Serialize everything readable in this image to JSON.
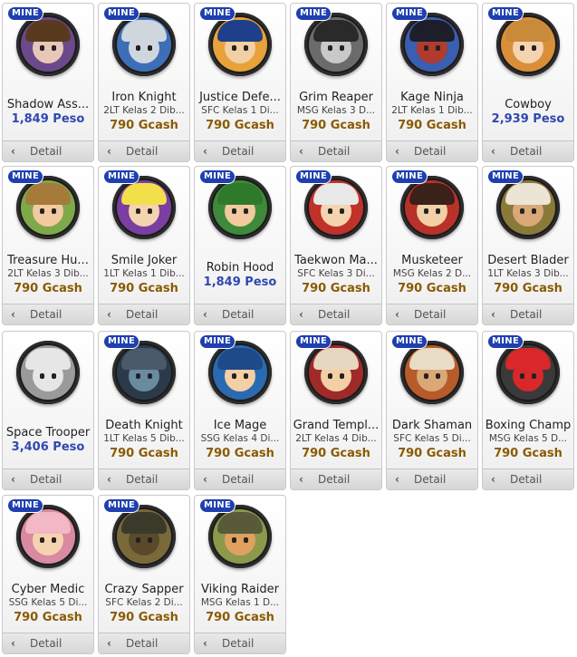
{
  "characters": [
    {
      "name": "Shadow Ass...",
      "requirement": "",
      "price": "1,849 Peso",
      "currency": "peso",
      "badge": "MINE",
      "detail": "Detail",
      "colors": {
        "bg": "#6a4a8a",
        "hat": "#5a3a1e",
        "face": "#e8c6b8"
      }
    },
    {
      "name": "Iron Knight",
      "requirement": "2LT Kelas 2  Dib...",
      "price": "790 Gcash",
      "currency": "gcash",
      "badge": "MINE",
      "detail": "Detail",
      "colors": {
        "bg": "#3d6fb8",
        "hat": "#cfd6de",
        "face": "#cfd6de"
      }
    },
    {
      "name": "Justice Defe...",
      "requirement": "SFC Kelas 1  Di...",
      "price": "790 Gcash",
      "currency": "gcash",
      "badge": "MINE",
      "detail": "Detail",
      "colors": {
        "bg": "#e8a23a",
        "hat": "#1f3f8a",
        "face": "#f2cfa4"
      }
    },
    {
      "name": "Grim Reaper",
      "requirement": "MSG Kelas 3  D...",
      "price": "790 Gcash",
      "currency": "gcash",
      "badge": "MINE",
      "detail": "Detail",
      "colors": {
        "bg": "#6b6b6b",
        "hat": "#2a2a2a",
        "face": "#c9c9c9"
      }
    },
    {
      "name": "Kage Ninja",
      "requirement": "2LT Kelas 1  Dib...",
      "price": "790 Gcash",
      "currency": "gcash",
      "badge": "MINE",
      "detail": "Detail",
      "colors": {
        "bg": "#3a5fb0",
        "hat": "#1e1e2a",
        "face": "#b23a2e"
      }
    },
    {
      "name": "Cowboy",
      "requirement": "",
      "price": "2,939 Peso",
      "currency": "peso",
      "badge": "MINE",
      "detail": "Detail",
      "colors": {
        "bg": "#d98f3a",
        "hat": "#c98a3a",
        "face": "#f6d3b0"
      }
    },
    {
      "name": "Treasure Hu...",
      "requirement": "2LT Kelas 3  Dib...",
      "price": "790 Gcash",
      "currency": "gcash",
      "badge": "MINE",
      "detail": "Detail",
      "colors": {
        "bg": "#7fa84a",
        "hat": "#a57a3a",
        "face": "#f2c9a0"
      }
    },
    {
      "name": "Smile Joker",
      "requirement": "1LT Kelas 1  Dib...",
      "price": "790 Gcash",
      "currency": "gcash",
      "badge": "MINE",
      "detail": "Detail",
      "colors": {
        "bg": "#7a3fa0",
        "hat": "#f2e04a",
        "face": "#f6d3b0"
      }
    },
    {
      "name": "Robin Hood",
      "requirement": "",
      "price": "1,849 Peso",
      "currency": "peso",
      "badge": "MINE",
      "detail": "Detail",
      "colors": {
        "bg": "#3f8a3a",
        "hat": "#2f7a2a",
        "face": "#f2c9a0"
      }
    },
    {
      "name": "Taekwon Ma...",
      "requirement": "SFC Kelas 3  Di...",
      "price": "790 Gcash",
      "currency": "gcash",
      "badge": "MINE",
      "detail": "Detail",
      "colors": {
        "bg": "#c0322a",
        "hat": "#e8e8e8",
        "face": "#f6d3b0"
      }
    },
    {
      "name": "Musketeer",
      "requirement": "MSG Kelas 2  D...",
      "price": "790 Gcash",
      "currency": "gcash",
      "badge": "MINE",
      "detail": "Detail",
      "colors": {
        "bg": "#b8322a",
        "hat": "#3a2218",
        "face": "#f2cfa4"
      }
    },
    {
      "name": "Desert Blader",
      "requirement": "1LT Kelas 3  Dib...",
      "price": "790 Gcash",
      "currency": "gcash",
      "badge": "MINE",
      "detail": "Detail",
      "colors": {
        "bg": "#8a7a3a",
        "hat": "#ece4d4",
        "face": "#d9a878"
      }
    },
    {
      "name": "Space Trooper",
      "requirement": "",
      "price": "3,406 Peso",
      "currency": "peso",
      "badge": "",
      "detail": "Detail",
      "colors": {
        "bg": "#9a9a9a",
        "hat": "#e6e6e6",
        "face": "#e6e6e6"
      }
    },
    {
      "name": "Death Knight",
      "requirement": "1LT Kelas 5  Dib...",
      "price": "790 Gcash",
      "currency": "gcash",
      "badge": "MINE",
      "detail": "Detail",
      "colors": {
        "bg": "#2a3a4a",
        "hat": "#4a5a6a",
        "face": "#6a8aa0"
      }
    },
    {
      "name": "Ice Mage",
      "requirement": "SSG Kelas 4  Di...",
      "price": "790 Gcash",
      "currency": "gcash",
      "badge": "MINE",
      "detail": "Detail",
      "colors": {
        "bg": "#2a6ab0",
        "hat": "#1e4a8a",
        "face": "#f2cfa4"
      }
    },
    {
      "name": "Grand Templ...",
      "requirement": "2LT Kelas 4  Dib...",
      "price": "790 Gcash",
      "currency": "gcash",
      "badge": "MINE",
      "detail": "Detail",
      "colors": {
        "bg": "#a02a2a",
        "hat": "#e6d8c0",
        "face": "#f2cfa4"
      }
    },
    {
      "name": "Dark Shaman",
      "requirement": "SFC Kelas 5  Di...",
      "price": "790 Gcash",
      "currency": "gcash",
      "badge": "MINE",
      "detail": "Detail",
      "colors": {
        "bg": "#b85a2a",
        "hat": "#e8dcc4",
        "face": "#d9a878"
      }
    },
    {
      "name": "Boxing Champ",
      "requirement": "MSG Kelas 5  D...",
      "price": "790 Gcash",
      "currency": "gcash",
      "badge": "MINE",
      "detail": "Detail",
      "colors": {
        "bg": "#3a3a3a",
        "hat": "#d8282a",
        "face": "#d8282a"
      }
    },
    {
      "name": "Cyber Medic",
      "requirement": "SSG Kelas 5  Di...",
      "price": "790 Gcash",
      "currency": "gcash",
      "badge": "MINE",
      "detail": "Detail",
      "colors": {
        "bg": "#d88aa0",
        "hat": "#f2b8c6",
        "face": "#f6d3b0"
      }
    },
    {
      "name": "Crazy Sapper",
      "requirement": "SFC Kelas 2  Di...",
      "price": "790 Gcash",
      "currency": "gcash",
      "badge": "MINE",
      "detail": "Detail",
      "colors": {
        "bg": "#7a6a3a",
        "hat": "#3a3a2a",
        "face": "#5a4a2a"
      }
    },
    {
      "name": "Viking Raider",
      "requirement": "MSG Kelas 1  D...",
      "price": "790 Gcash",
      "currency": "gcash",
      "badge": "MINE",
      "detail": "Detail",
      "colors": {
        "bg": "#8a9a4a",
        "hat": "#5a5a3a",
        "face": "#e0a060"
      }
    }
  ]
}
